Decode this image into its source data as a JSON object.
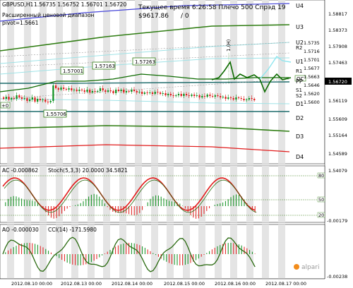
{
  "header": {
    "symbol": "GBPUSD,H1",
    "quotes": "1.56735 1.56752 1.56701 1.56720",
    "indicator": "Расширенный ценовой диапазон",
    "pivot": "pivot=1.5661",
    "center_info": "Текущее время 6:26:58 Плечо 500 Спрэд 19",
    "balance": "$9617.86",
    "balance_right": "/ 0"
  },
  "price_axis": {
    "ticks": [
      "1.58817",
      "1.58373",
      "1.57908",
      "1.57463",
      "1.56720",
      "1.56119",
      "1.55609",
      "1.55164",
      "1.54589",
      "1.54079"
    ],
    "current_price": "1.56720"
  },
  "level_labels": [
    "U4",
    "U3",
    "U2",
    "U1",
    "R2",
    "R1",
    "PP",
    "S1",
    "S2",
    "D1",
    "D2",
    "D3",
    "D4"
  ],
  "mini_level_values": [
    "1.5735",
    "1.5716",
    "1.5701",
    "1.5677",
    "1.5663",
    "1.5646",
    "1.5620",
    "1.5600"
  ],
  "price_boxes": [
    "1.57001",
    "1.57163",
    "1.57263",
    "1.55706"
  ],
  "markers": {
    "left_tag": "+0",
    "oc_tag": "OC",
    "high_tag": "1.(H)"
  },
  "ac_panel": {
    "label": "AC -0.000862",
    "stoch": "Stoch(5,3,3) 20.0000 34.5821",
    "levels": [
      "80",
      "50",
      "20"
    ],
    "min_value": "-0.00179"
  },
  "ao_panel": {
    "label": "AO -0.000030",
    "cci": "CCI(14) -171.5980",
    "min_value": "-0.00238"
  },
  "watermark": "alpari",
  "time_axis": [
    "2012.08.10 00:00",
    "2012.08.13 00:00",
    "2012.08.14 00:00",
    "2012.08.15 00:00",
    "2012.08.16 00:00",
    "2012.08.17 00:00"
  ],
  "colors": {
    "candle_up": "#0b8f1c",
    "candle_down": "#e11b1b",
    "pivot_line": "#1d6b6b",
    "green_band": "#2f7d12",
    "light_band": "#9fe3e7",
    "ma_line": "#0d6b00",
    "stoch_red": "#e11b1b",
    "cci_green": "#2a6a10"
  }
}
